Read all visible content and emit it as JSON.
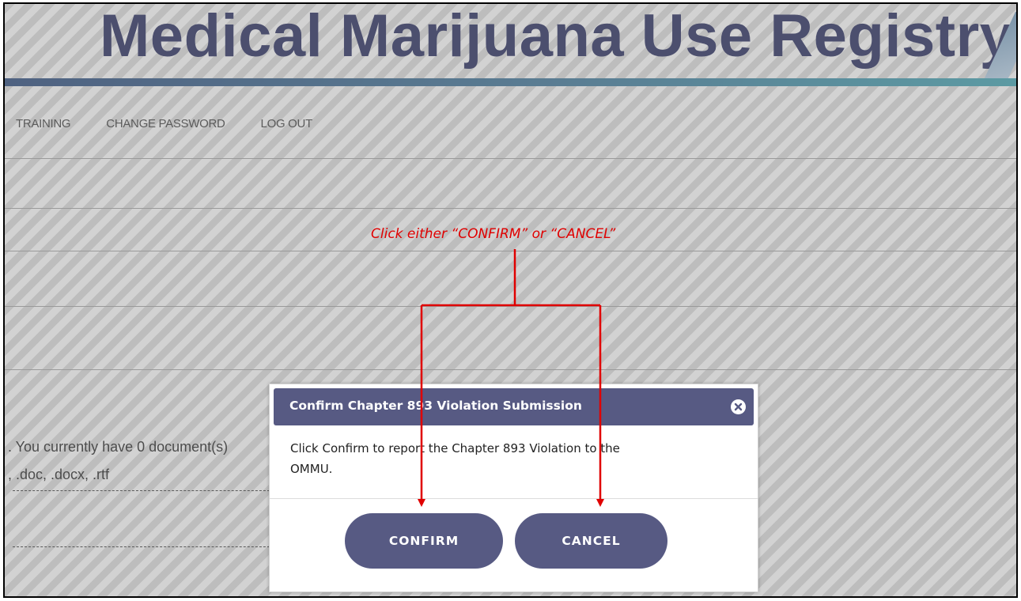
{
  "banner": {
    "title": "Medical Marijuana Use Registry"
  },
  "nav": {
    "items": [
      "TRAINING",
      "CHANGE PASSWORD",
      "LOG OUT"
    ]
  },
  "background": {
    "partial_line_1": ". You currently have 0 document(s)",
    "partial_line_2": ", .doc, .docx, .rtf"
  },
  "dialog": {
    "title": "Confirm Chapter 893 Violation Submission",
    "message_line_1": "Click Confirm to report the Chapter 893 Violation to the",
    "message_line_2": "OMMU.",
    "confirm_label": "CONFIRM",
    "cancel_label": "CANCEL",
    "close_icon": "close-circle-icon"
  },
  "annotation": {
    "text": "Click either “CONFIRM” or “CANCEL”",
    "color": "#e00000"
  },
  "colors": {
    "dialog_accent": "#575a83",
    "annotation": "#e00000"
  }
}
